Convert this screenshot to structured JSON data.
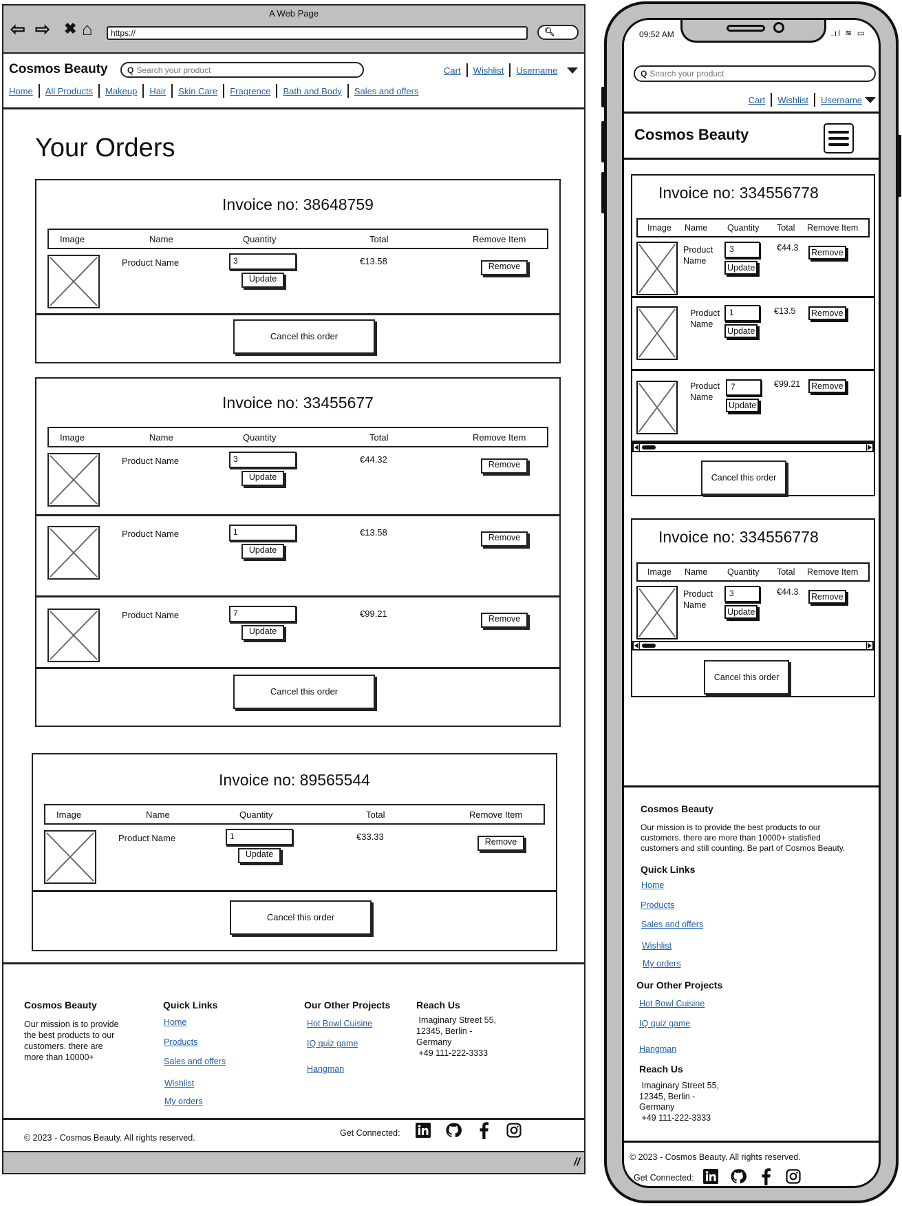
{
  "browser": {
    "window_title": "A Web Page",
    "url": "https://",
    "nav_icons": [
      "back-arrow-icon",
      "forward-arrow-icon",
      "close-x-icon",
      "home-icon"
    ]
  },
  "site": {
    "logo": "Cosmos Beauty",
    "search_placeholder": "Search your product",
    "user_links": {
      "cart": "Cart",
      "wishlist": "Wishlist",
      "username": "Username"
    },
    "nav": [
      "Home",
      "All Products",
      "Makeup",
      "Hair",
      "Skin Care",
      "Fragrence",
      "Bath and Body",
      "Sales and offers"
    ]
  },
  "orders_page": {
    "title": "Your Orders",
    "table_headers": {
      "image": "Image",
      "name": "Name",
      "quantity": "Quantity",
      "total": "Total",
      "remove": "Remove Item"
    },
    "update_label": "Update",
    "remove_label": "Remove",
    "cancel_label": "Cancel this order",
    "invoices": [
      {
        "title": "Invoice no: 38648759",
        "items": [
          {
            "name": "Product Name",
            "qty": "3",
            "total": "€13.58"
          }
        ]
      },
      {
        "title": "Invoice no: 33455677",
        "items": [
          {
            "name": "Product Name",
            "qty": "3",
            "total": "€44.32"
          },
          {
            "name": "Product Name",
            "qty": "1",
            "total": "€13.58"
          },
          {
            "name": "Product Name",
            "qty": "7",
            "total": "€99.21"
          }
        ]
      },
      {
        "title": "Invoice no: 89565544",
        "items": [
          {
            "name": "Product Name",
            "qty": "1",
            "total": "€33.33"
          }
        ]
      }
    ]
  },
  "footer": {
    "about_heading": "Cosmos Beauty",
    "about_text_desktop": "Our mission is to provide the best products to our customers. there are more than 10000+",
    "about_text_mobile": "Our mission is to provide the best products to our customers. there are more than 10000+ statisfied customers and still counting. Be part of Cosmos Beauty.",
    "quick_links_heading": "Quick Links",
    "quick_links": [
      "Home",
      "Products",
      "Sales and offers",
      "Wishlist",
      "My orders"
    ],
    "projects_heading": "Our Other Projects",
    "projects": [
      "Hot Bowl Cuisine",
      "IQ quiz game",
      "Hangman"
    ],
    "reach_heading": "Reach Us",
    "address_line1": " Imaginary Street 55,",
    "address_line2": "12345, Berlin -",
    "address_line3": "Germany",
    "phone": " +49 111-222-3333",
    "copyright": "© 2023 - Cosmos Beauty. All rights reserved.",
    "get_connected": "Get Connected:",
    "social_icons": [
      "linkedin-icon",
      "github-icon",
      "facebook-icon",
      "instagram-icon"
    ]
  },
  "mobile": {
    "status_time": "09:52 AM",
    "invoices": [
      {
        "title": "Invoice no: 334556778",
        "items": [
          {
            "name": "Product Name",
            "qty": "3",
            "total": "€44.3"
          },
          {
            "name": "Product Name",
            "qty": "1",
            "total": "€13.5"
          },
          {
            "name": "Product Name",
            "qty": "7",
            "total": "€99.21"
          }
        ]
      },
      {
        "title": "Invoice no: 334556778",
        "items": [
          {
            "name": "Product Name",
            "qty": "3",
            "total": "€44.3"
          }
        ]
      }
    ]
  }
}
